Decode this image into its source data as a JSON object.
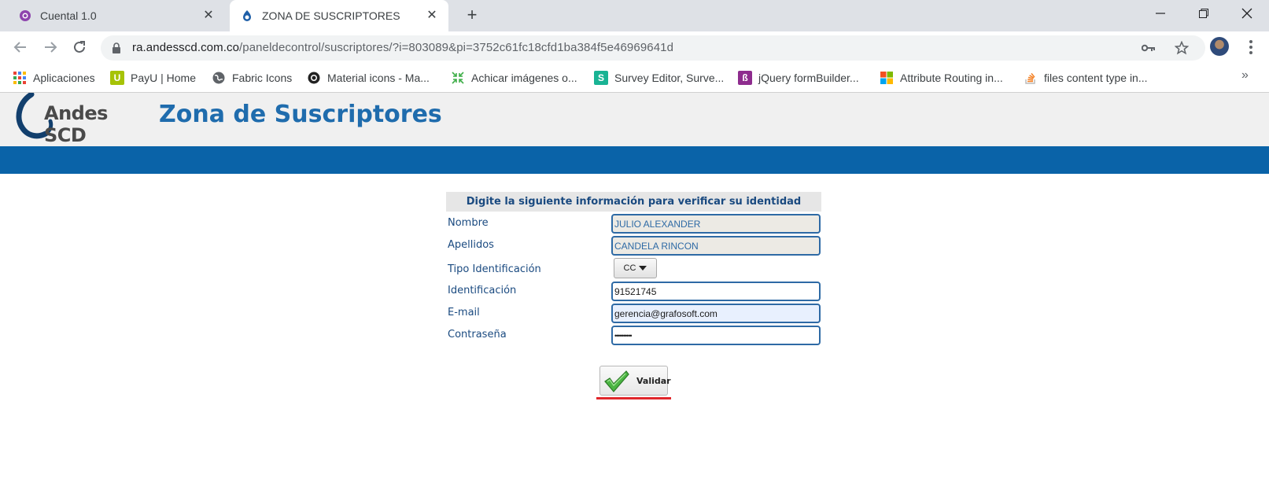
{
  "browser": {
    "tabs": [
      {
        "title": "Cuental 1.0",
        "active": false
      },
      {
        "title": "ZONA DE SUSCRIPTORES",
        "active": true
      }
    ],
    "url_host": "ra.andesscd.com.co",
    "url_path": "/paneldecontrol/suscriptores/?i=803089&pi=3752c61fc18cfd1ba384f5e46969641d",
    "bookmarks": [
      {
        "label": "Aplicaciones",
        "icon": "apps-grid-icon"
      },
      {
        "label": "PayU | Home",
        "icon": "payu-icon"
      },
      {
        "label": "Fabric Icons",
        "icon": "globe-icon"
      },
      {
        "label": "Material icons - Ma...",
        "icon": "lifebuoy-icon"
      },
      {
        "label": "Achicar imágenes o...",
        "icon": "compress-icon"
      },
      {
        "label": "Survey Editor, Surve...",
        "icon": "surveyjs-icon"
      },
      {
        "label": "jQuery formBuilder...",
        "icon": "formbuilder-icon"
      },
      {
        "label": "Attribute Routing in...",
        "icon": "microsoft-icon"
      },
      {
        "label": "files content type in...",
        "icon": "stackoverflow-icon"
      }
    ],
    "more_bookmarks": "»"
  },
  "page": {
    "logo_text": "Andes SCD",
    "title": "Zona de Suscriptores",
    "colors": {
      "brand_blue": "#0a63a8",
      "title_blue": "#1f6cad",
      "underline_red": "#e0262b"
    }
  },
  "form": {
    "heading": "Digite la siguiente información para verificar su identidad",
    "fields": {
      "nombre": {
        "label": "Nombre",
        "value": "JULIO ALEXANDER"
      },
      "apellidos": {
        "label": "Apellidos",
        "value": "CANDELA RINCON"
      },
      "tipo": {
        "label": "Tipo Identificación",
        "value": "CC"
      },
      "identificacion": {
        "label": "Identificación",
        "value": "91521745"
      },
      "email": {
        "label": "E-mail",
        "value": "gerencia@grafosoft.com"
      },
      "password": {
        "label": "Contraseña",
        "value": "••••••••••"
      }
    },
    "submit_label": "Validar"
  }
}
